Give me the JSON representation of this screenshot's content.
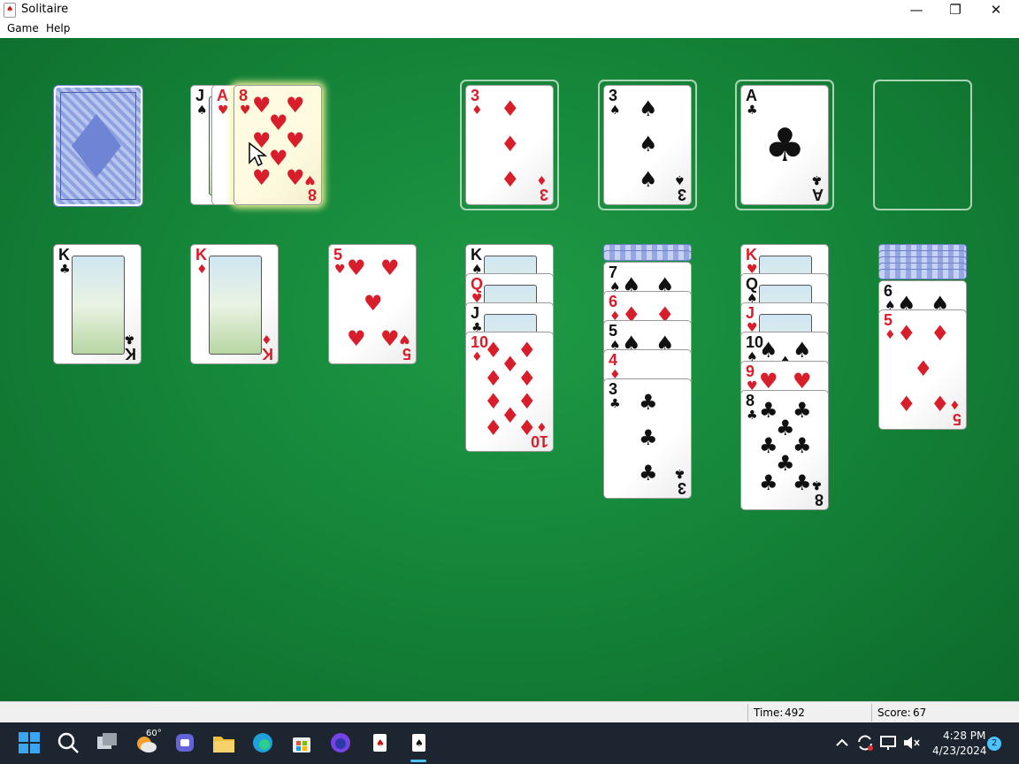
{
  "window": {
    "title": "Solitaire",
    "minimize": "—",
    "restore": "❐",
    "close": "✕"
  },
  "menu": {
    "game": "Game",
    "help": "Help"
  },
  "stock": {
    "icon": "card-back"
  },
  "waste": [
    {
      "rank": "J",
      "suit": "♠"
    },
    {
      "rank": "A",
      "suit": "♥"
    },
    {
      "rank": "8",
      "suit": "♥"
    }
  ],
  "foundations": [
    {
      "rank": "3",
      "suit": "♦"
    },
    {
      "rank": "3",
      "suit": "♠"
    },
    {
      "rank": "A",
      "suit": "♣"
    },
    {
      "rank": "",
      "suit": ""
    }
  ],
  "tableau": [
    {
      "hidden": 0,
      "cards": [
        {
          "rank": "K",
          "suit": "♣"
        }
      ]
    },
    {
      "hidden": 0,
      "cards": [
        {
          "rank": "K",
          "suit": "♦"
        }
      ]
    },
    {
      "hidden": 0,
      "cards": [
        {
          "rank": "5",
          "suit": "♥"
        }
      ]
    },
    {
      "hidden": 0,
      "cards": [
        {
          "rank": "K",
          "suit": "♠"
        },
        {
          "rank": "Q",
          "suit": "♥"
        },
        {
          "rank": "J",
          "suit": "♣"
        },
        {
          "rank": "10",
          "suit": "♦"
        }
      ]
    },
    {
      "hidden": 2,
      "cards": [
        {
          "rank": "7",
          "suit": "♠"
        },
        {
          "rank": "6",
          "suit": "♦"
        },
        {
          "rank": "5",
          "suit": "♠"
        },
        {
          "rank": "4",
          "suit": "♦"
        },
        {
          "rank": "3",
          "suit": "♣"
        }
      ]
    },
    {
      "hidden": 0,
      "cards": [
        {
          "rank": "K",
          "suit": "♥"
        },
        {
          "rank": "Q",
          "suit": "♠"
        },
        {
          "rank": "J",
          "suit": "♥"
        },
        {
          "rank": "10",
          "suit": "♠"
        },
        {
          "rank": "9",
          "suit": "♥"
        },
        {
          "rank": "8",
          "suit": "♣"
        }
      ]
    },
    {
      "hidden": 5,
      "cards": [
        {
          "rank": "6",
          "suit": "♠"
        },
        {
          "rank": "5",
          "suit": "♦"
        }
      ]
    }
  ],
  "status": {
    "time_label": "Time:",
    "time": "492",
    "score_label": "Score:",
    "score": "67"
  },
  "taskbar": {
    "weather_temp": "60°",
    "clock_time": "4:28 PM",
    "clock_date": "4/23/2024",
    "notifications": "2"
  },
  "colors": {
    "felt": "#15863a",
    "red_suit": "#d81e2a",
    "black_suit": "#111111",
    "card_back": "#8fa2e0"
  }
}
